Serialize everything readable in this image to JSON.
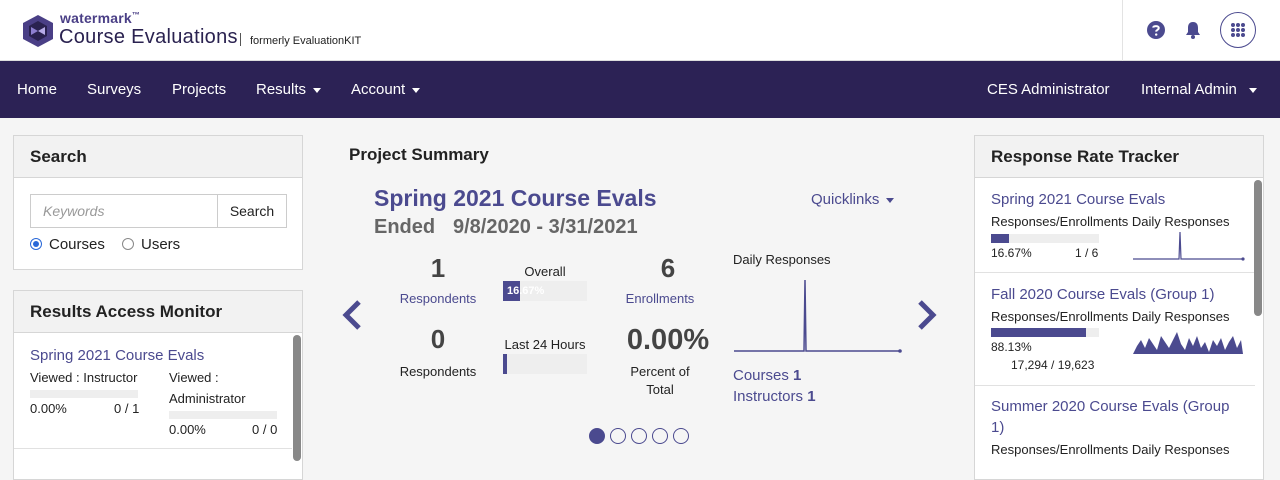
{
  "header": {
    "brand_small": "watermark",
    "brand_tm": "™",
    "product": "Course Evaluations",
    "formerly": "formerly EvaluationKIT"
  },
  "nav": {
    "home": "Home",
    "surveys": "Surveys",
    "projects": "Projects",
    "results": "Results",
    "account": "Account",
    "role": "CES Administrator",
    "user": "Internal Admin"
  },
  "search": {
    "title": "Search",
    "placeholder": "Keywords",
    "button": "Search",
    "opt_courses": "Courses",
    "opt_users": "Users",
    "selected": "Courses"
  },
  "ram": {
    "title": "Results Access Monitor",
    "project": "Spring 2021 Course Evals",
    "instructor_label": "Viewed : Instructor",
    "instructor_pct": "0.00%",
    "instructor_count": "0 / 1",
    "admin_label_1": "Viewed :",
    "admin_label_2": "Administrator",
    "admin_pct": "0.00%",
    "admin_count": "0 / 0"
  },
  "summary": {
    "title": "Project Summary",
    "course": "Spring 2021 Course Evals",
    "status": "Ended",
    "dates": "9/8/2020 - 3/31/2021",
    "quicklinks": "Quicklinks",
    "respondents_total": "1",
    "respondents_label": "Respondents",
    "overall_label": "Overall",
    "overall_pct": "16.67%",
    "overall_fraction": 0.1667,
    "enrollments_total": "6",
    "enrollments_label": "Enrollments",
    "respondents_24h": "0",
    "respondents_24h_label": "Respondents",
    "last24_label": "Last 24 Hours",
    "last24_fraction": 0,
    "percent_total": "0.00%",
    "percent_total_label_1": "Percent of",
    "percent_total_label_2": "Total",
    "daily_label": "Daily Responses",
    "courses_label": "Courses",
    "courses_count": "1",
    "instructors_label": "Instructors",
    "instructors_count": "1",
    "active_slide": 0,
    "slide_count": 5
  },
  "rrt": {
    "title": "Response Rate Tracker",
    "items": [
      {
        "name": "Spring 2021 Course Evals",
        "sub": "Responses/Enrollments Daily Responses",
        "pct": "16.67%",
        "count": "1 / 6",
        "fraction": 0.1667
      },
      {
        "name": "Fall 2020 Course Evals (Group 1)",
        "sub": "Responses/Enrollments Daily Responses",
        "pct": "88.13%",
        "count": "17,294 / 19,623",
        "fraction": 0.8813
      },
      {
        "name_1": "Summer 2020 Course Evals (Group",
        "name_2": "1)",
        "sub": "Responses/Enrollments Daily Responses"
      }
    ]
  },
  "colors": {
    "brand": "#4b4a8f",
    "nav_bg": "#2c2255",
    "panel_head": "#f2f2f2"
  }
}
